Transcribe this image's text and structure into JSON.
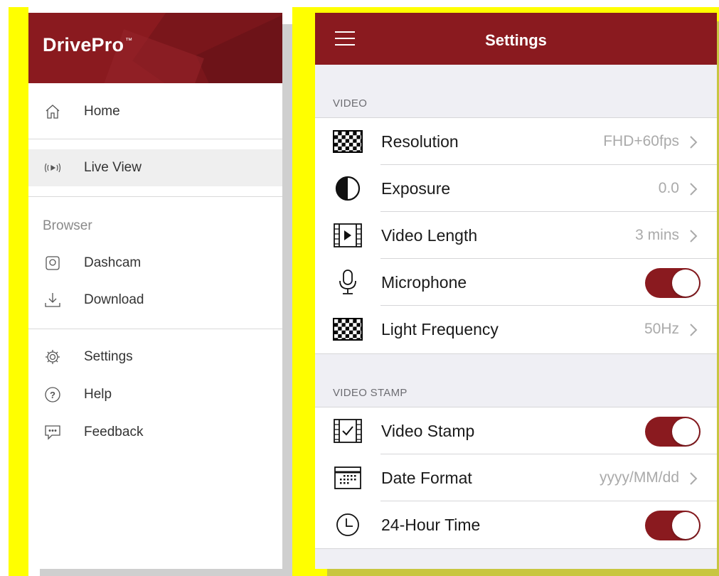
{
  "drawer": {
    "brand": "DrivePro",
    "brand_mark": "™",
    "items": [
      {
        "label": "Home",
        "icon": "home-icon"
      },
      {
        "label": "Live View",
        "icon": "live-view-icon"
      },
      {
        "label": "Dashcam",
        "icon": "dashcam-icon"
      },
      {
        "label": "Download",
        "icon": "download-icon"
      },
      {
        "label": "Settings",
        "icon": "settings-icon"
      },
      {
        "label": "Help",
        "icon": "help-icon"
      },
      {
        "label": "Feedback",
        "icon": "feedback-icon"
      }
    ],
    "section_browser": "Browser"
  },
  "settings": {
    "title": "Settings",
    "groups": {
      "video": {
        "label": "VIDEO",
        "rows": [
          {
            "label": "Resolution",
            "value": "FHD+60fps",
            "icon": "resolution-icon"
          },
          {
            "label": "Exposure",
            "value": "0.0",
            "icon": "exposure-icon"
          },
          {
            "label": "Video Length",
            "value": "3 mins",
            "icon": "video-length-icon"
          },
          {
            "label": "Microphone",
            "toggle": true,
            "icon": "microphone-icon"
          },
          {
            "label": "Light Frequency",
            "value": "50Hz",
            "icon": "light-frequency-icon"
          }
        ]
      },
      "video_stamp": {
        "label": "VIDEO STAMP",
        "rows": [
          {
            "label": "Video Stamp",
            "toggle": true,
            "icon": "video-stamp-icon"
          },
          {
            "label": "Date Format",
            "value": "yyyy/MM/dd",
            "icon": "calendar-icon"
          },
          {
            "label": "24-Hour Time",
            "toggle": true,
            "icon": "clock-icon"
          }
        ]
      }
    }
  },
  "colors": {
    "accent": "#8a1a1f",
    "highlight": "#ffff00"
  }
}
